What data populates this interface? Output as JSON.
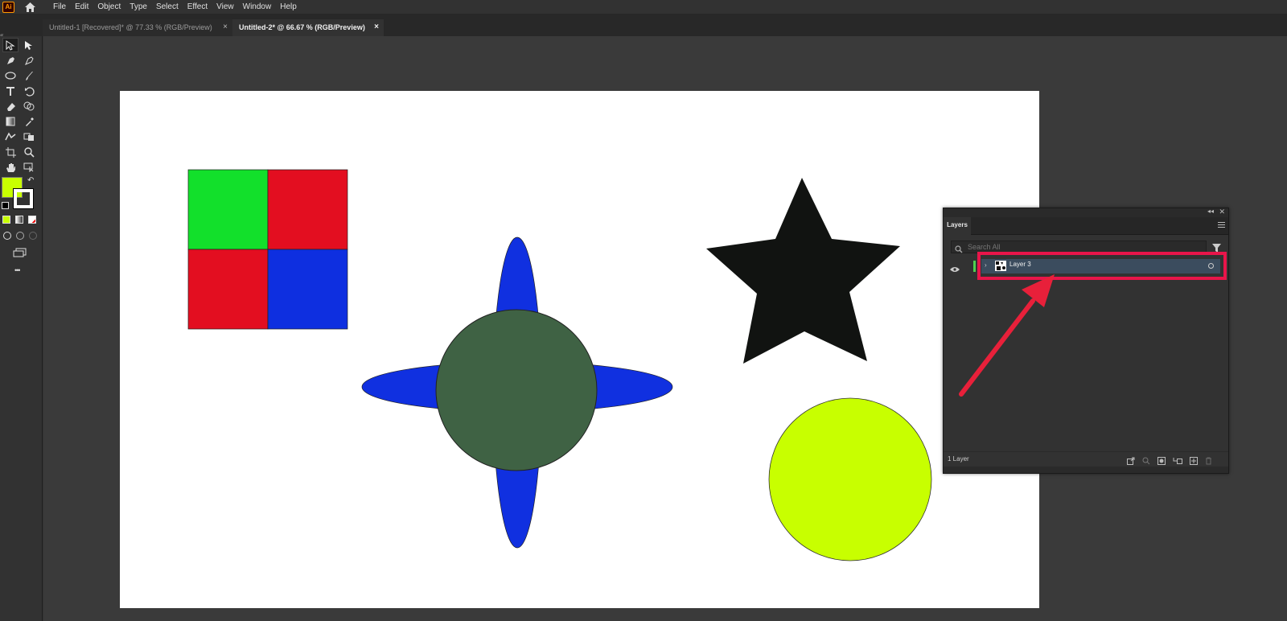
{
  "app": {
    "logo_text": "Ai",
    "brand_color": "#ff9a00"
  },
  "menu": [
    "File",
    "Edit",
    "Object",
    "Type",
    "Select",
    "Effect",
    "View",
    "Window",
    "Help"
  ],
  "tabs": [
    {
      "label": "Untitled-1 [Recovered]* @ 77.33 % (RGB/Preview)",
      "close": "×",
      "active": false
    },
    {
      "label": "Untitled-2* @ 66.67 % (RGB/Preview)",
      "close": "×",
      "active": true
    }
  ],
  "toolbar": {
    "fill_color": "#c8ff00",
    "stroke_color": "#000000",
    "more": "•••"
  },
  "artwork": {
    "grid_colors": [
      "#12e02b",
      "#e30e20",
      "#e30e20",
      "#0e2fe0"
    ],
    "ellipse_color": "#1030e0",
    "center_circle_color": "#3f6244",
    "star_color": "#111311",
    "yellow_circle_color": "#c8ff00"
  },
  "layers_panel": {
    "tab_label": "Layers",
    "search_placeholder": "Search All",
    "layers": [
      {
        "name": "Layer 3",
        "color": "#4fd04f"
      }
    ],
    "footer_count": "1 Layer"
  },
  "annotation": {
    "highlight_color": "#e8154a",
    "arrow_color": "#e8203a"
  }
}
